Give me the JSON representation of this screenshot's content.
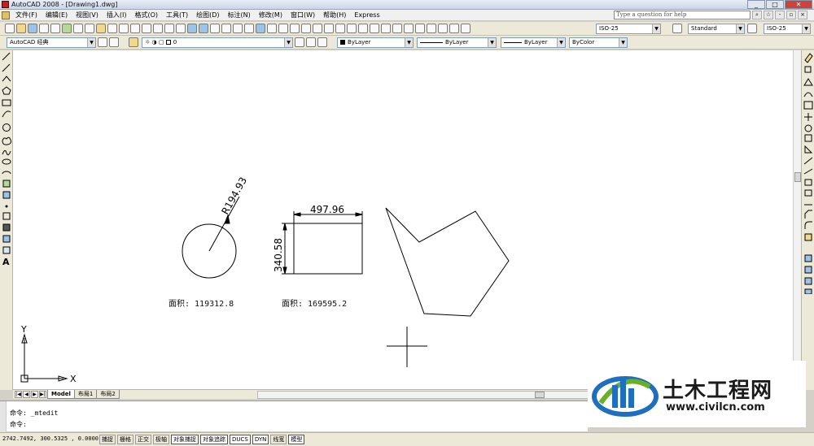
{
  "window": {
    "title": "AutoCAD 2008 - [Drawing1.dwg]",
    "buttons": [
      "_",
      "□",
      "✕"
    ]
  },
  "menu": {
    "items": [
      "文件(F)",
      "编辑(E)",
      "视图(V)",
      "插入(I)",
      "格式(O)",
      "工具(T)",
      "绘图(D)",
      "标注(N)",
      "修改(M)",
      "窗口(W)",
      "帮助(H)",
      "Express"
    ],
    "help_search_placeholder": "Type a question for help"
  },
  "toolbar": {
    "dimstyle": "ISO-25",
    "textstyle": "Standard",
    "tablestyle": "ISO-25",
    "workspace": "AutoCAD 经典",
    "layer": "0",
    "color": "ByLayer",
    "linetype": "ByLayer",
    "lineweight": "ByLayer",
    "plotstyle": "ByColor"
  },
  "drawing": {
    "circle_dim": "R194.93",
    "rect_width_dim": "497.96",
    "rect_height_dim": "340.58",
    "circle_area_label": "面积: 119312.8",
    "rect_area_label": "面积: 169595.2",
    "ucs_x": "X",
    "ucs_y": "Y"
  },
  "tabs": {
    "items": [
      "Model",
      "布局1",
      "布局2"
    ],
    "active": "Model",
    "nav": [
      "|◀",
      "◀",
      "▶",
      "▶|"
    ]
  },
  "command": {
    "line1": "命令: _mtedit",
    "line2": "命令:"
  },
  "status": {
    "coords": "2742.7492, 300.5325 , 0.0000",
    "toggles": [
      "捕捉",
      "栅格",
      "正交",
      "极轴",
      "对象捕捉",
      "对象追踪",
      "DUCS",
      "DYN",
      "线宽",
      "模型"
    ],
    "toggles_on": [
      "对象捕捉",
      "对象追踪",
      "DUCS",
      "DYN",
      "模型"
    ]
  },
  "watermark": {
    "brand": "土木工程网",
    "url": "www.civilcn.com"
  },
  "colors": {
    "close_button": "#c9453c",
    "watermark_blue": "#1e6fc0",
    "watermark_green": "#6ab023"
  }
}
